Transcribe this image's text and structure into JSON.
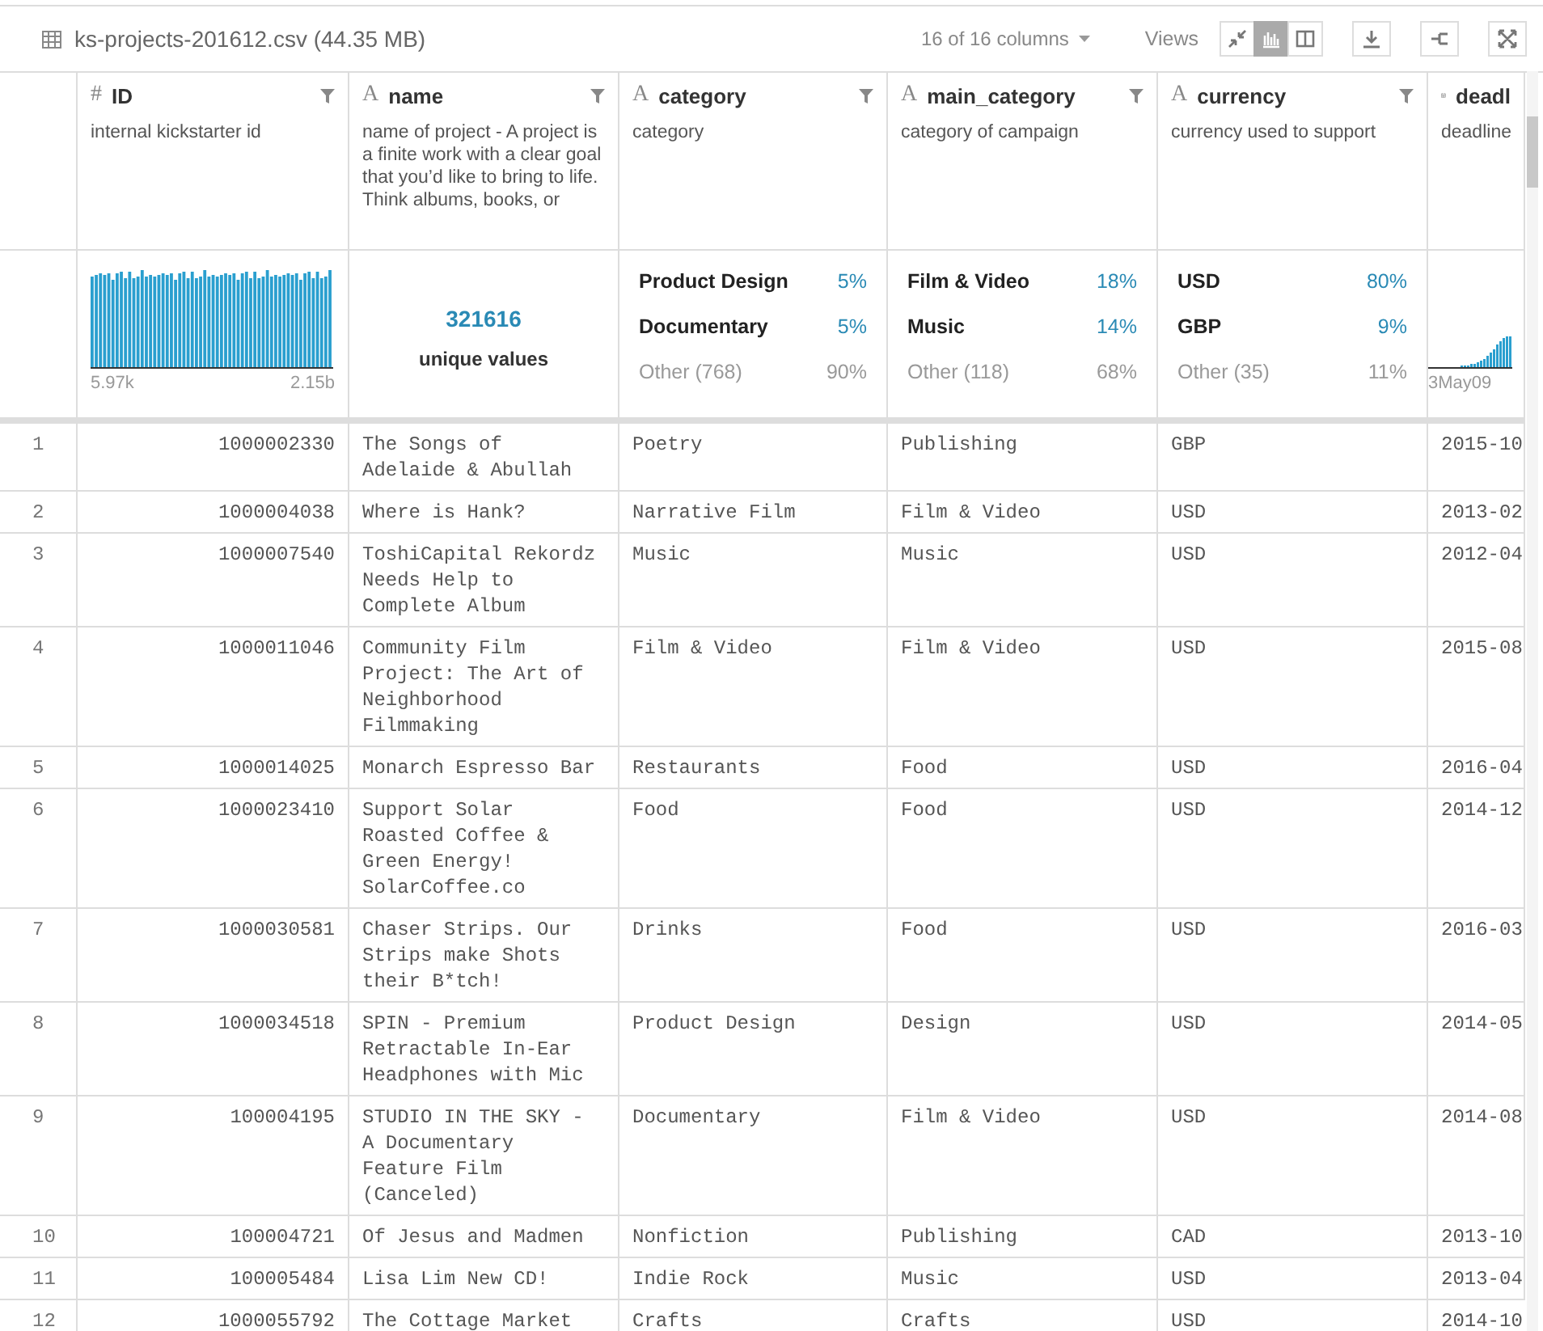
{
  "file": {
    "title": "ks-projects-201612.csv (44.35 MB)",
    "columns_picker": "16 of 16 columns",
    "views_label": "Views"
  },
  "views": [
    {
      "kind": "compact",
      "selected": false
    },
    {
      "kind": "histogram",
      "selected": true
    },
    {
      "kind": "columns",
      "selected": false
    }
  ],
  "actions": [
    {
      "kind": "download"
    },
    {
      "kind": "tree"
    },
    {
      "kind": "expand"
    }
  ],
  "columns": [
    {
      "kind": "numeric",
      "glyph": "#",
      "name": "ID",
      "description": "internal kickstarter id",
      "filter": true,
      "stats": {
        "kind": "histogram",
        "min": "5.97k",
        "max": "2.15b"
      }
    },
    {
      "kind": "string",
      "glyph": "A",
      "name": "name",
      "description": "name of project - A project is a finite work with a clear goal that you’d like to bring to life. Think albums, books, or",
      "filter": true,
      "stats": {
        "kind": "unique",
        "value": "321616",
        "label": "unique values"
      }
    },
    {
      "kind": "string",
      "glyph": "A",
      "name": "category",
      "description": "category",
      "filter": true,
      "stats": {
        "kind": "top",
        "items": [
          {
            "label": "Product Design",
            "pct": "5%"
          },
          {
            "label": "Documentary",
            "pct": "5%"
          }
        ],
        "other": {
          "label": "Other (768)",
          "pct": "90%"
        }
      }
    },
    {
      "kind": "string",
      "glyph": "A",
      "name": "main_category",
      "description": "category of campaign",
      "filter": true,
      "stats": {
        "kind": "top",
        "items": [
          {
            "label": "Film & Video",
            "pct": "18%"
          },
          {
            "label": "Music",
            "pct": "14%"
          }
        ],
        "other": {
          "label": "Other (118)",
          "pct": "68%"
        }
      }
    },
    {
      "kind": "string",
      "glyph": "A",
      "name": "currency",
      "description": "currency used to support",
      "filter": true,
      "stats": {
        "kind": "top",
        "items": [
          {
            "label": "USD",
            "pct": "80%"
          },
          {
            "label": "GBP",
            "pct": "9%"
          }
        ],
        "other": {
          "label": "Other (35)",
          "pct": "11%"
        }
      }
    },
    {
      "kind": "date",
      "name": "deadl",
      "description": "deadline",
      "filter": false,
      "stats": {
        "kind": "timeline",
        "min": "3May09"
      }
    }
  ],
  "rows": [
    {
      "num": "1",
      "cells": [
        "1000002330",
        "The Songs of Adelaide & Abullah",
        "Poetry",
        "Publishing",
        "GBP",
        "2015-10"
      ]
    },
    {
      "num": "2",
      "cells": [
        "1000004038",
        "Where is Hank?",
        "Narrative Film",
        "Film & Video",
        "USD",
        "2013-02"
      ]
    },
    {
      "num": "3",
      "cells": [
        "1000007540",
        "ToshiCapital Rekordz Needs Help to Complete Album",
        "Music",
        "Music",
        "USD",
        "2012-04"
      ]
    },
    {
      "num": "4",
      "cells": [
        "1000011046",
        "Community Film Project: The Art of Neighborhood Filmmaking",
        "Film & Video",
        "Film & Video",
        "USD",
        "2015-08"
      ]
    },
    {
      "num": "5",
      "cells": [
        "1000014025",
        "Monarch Espresso Bar",
        "Restaurants",
        "Food",
        "USD",
        "2016-04"
      ]
    },
    {
      "num": "6",
      "cells": [
        "1000023410",
        "Support Solar Roasted Coffee & Green Energy! SolarCoffee.co",
        "Food",
        "Food",
        "USD",
        "2014-12"
      ]
    },
    {
      "num": "7",
      "cells": [
        "1000030581",
        "Chaser Strips. Our Strips make Shots their B*tch!",
        "Drinks",
        "Food",
        "USD",
        "2016-03"
      ]
    },
    {
      "num": "8",
      "cells": [
        "1000034518",
        "SPIN - Premium Retractable In-Ear Headphones with Mic",
        "Product Design",
        "Design",
        "USD",
        "2014-05"
      ]
    },
    {
      "num": "9",
      "cells": [
        "100004195",
        "STUDIO IN THE SKY - A Documentary Feature Film (Canceled)",
        "Documentary",
        "Film & Video",
        "USD",
        "2014-08"
      ]
    },
    {
      "num": "10",
      "cells": [
        "100004721",
        "Of Jesus and Madmen",
        "Nonfiction",
        "Publishing",
        "CAD",
        "2013-10"
      ]
    },
    {
      "num": "11",
      "cells": [
        "100005484",
        "Lisa Lim New CD!",
        "Indie Rock",
        "Music",
        "USD",
        "2013-04"
      ]
    },
    {
      "num": "12",
      "cells": [
        "1000055792",
        "The Cottage Market",
        "Crafts",
        "Crafts",
        "USD",
        "2014-10"
      ]
    }
  ]
}
